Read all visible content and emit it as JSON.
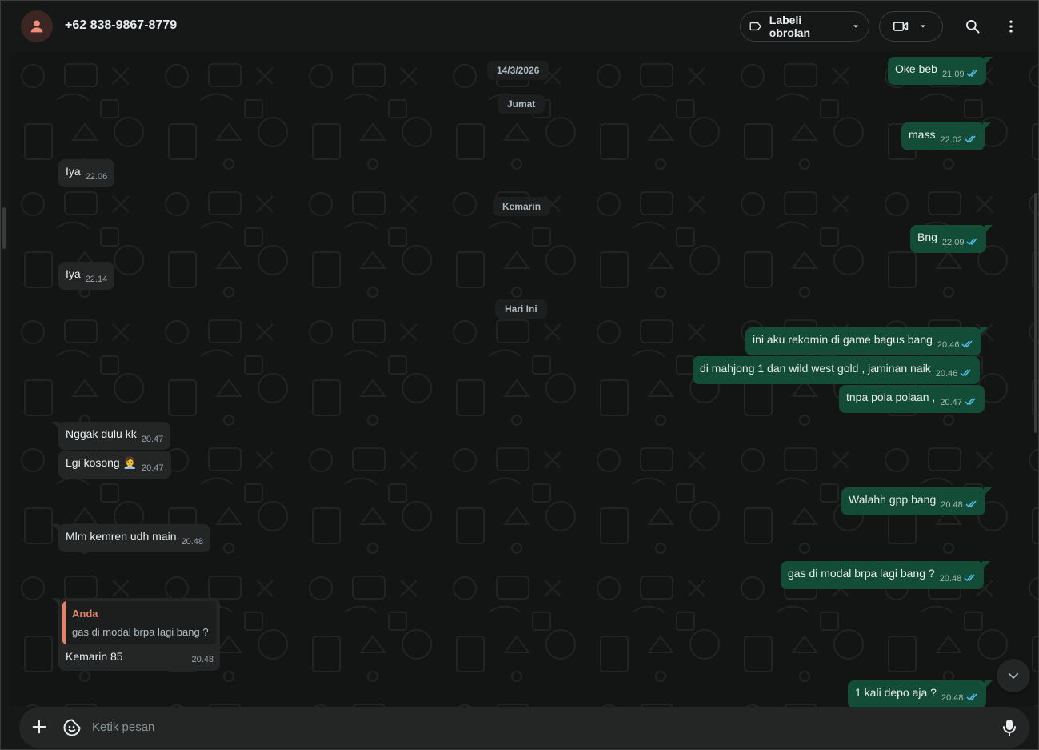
{
  "header": {
    "contact_name": "+62 838-9867-8779",
    "label_button": "Labeli obrolan",
    "icons": [
      "person-icon",
      "label-icon",
      "chevron-down-icon",
      "video-icon",
      "search-icon",
      "menu-icon"
    ]
  },
  "dates": {
    "d1": "14/3/2026",
    "d2": "Jumat",
    "d3": "Kemarin",
    "d4": "Hari Ini"
  },
  "messages": [
    {
      "dir": "out",
      "text": "Oke beb",
      "time": "21.09"
    },
    {
      "dir": "out",
      "text": "mass",
      "time": "22.02"
    },
    {
      "dir": "in",
      "text": "Iya",
      "time": "22.06"
    },
    {
      "dir": "out",
      "text": "Bng",
      "time": "22.09"
    },
    {
      "dir": "in",
      "text": "Iya",
      "time": "22.14"
    },
    {
      "dir": "out",
      "text": "ini aku rekomin di game bagus bang",
      "time": "20.46"
    },
    {
      "dir": "out",
      "text": "di mahjong 1 dan wild west gold , jaminan naik",
      "time": "20.46"
    },
    {
      "dir": "out",
      "text": "tnpa pola polaan ,",
      "time": "20.47"
    },
    {
      "dir": "in",
      "text": "Nggak dulu kk",
      "time": "20.47"
    },
    {
      "dir": "in",
      "text": "Lgi kosong",
      "emoji": "🧑‍💼",
      "time": "20.47"
    },
    {
      "dir": "out",
      "text": "Walahh gpp bang",
      "time": "20.48"
    },
    {
      "dir": "in",
      "text": "Mlm kemren udh main",
      "time": "20.48"
    },
    {
      "dir": "out",
      "text": "gas di modal brpa lagi bang ?",
      "time": "20.48"
    },
    {
      "dir": "in",
      "text": "Kemarin 85",
      "time": "20.48",
      "quote_author": "Anda",
      "quote_text": "gas di modal brpa lagi bang ?"
    },
    {
      "dir": "out",
      "text": "1 kali depo aja ?",
      "time": "20.48"
    }
  ],
  "composer": {
    "placeholder": "Ketik pesan"
  },
  "colors": {
    "outgoing_bubble": "#144d37",
    "incoming_bubble": "#242626",
    "background": "#161717",
    "quote_accent": "#e7826a",
    "read_ticks": "#53bdeb"
  }
}
